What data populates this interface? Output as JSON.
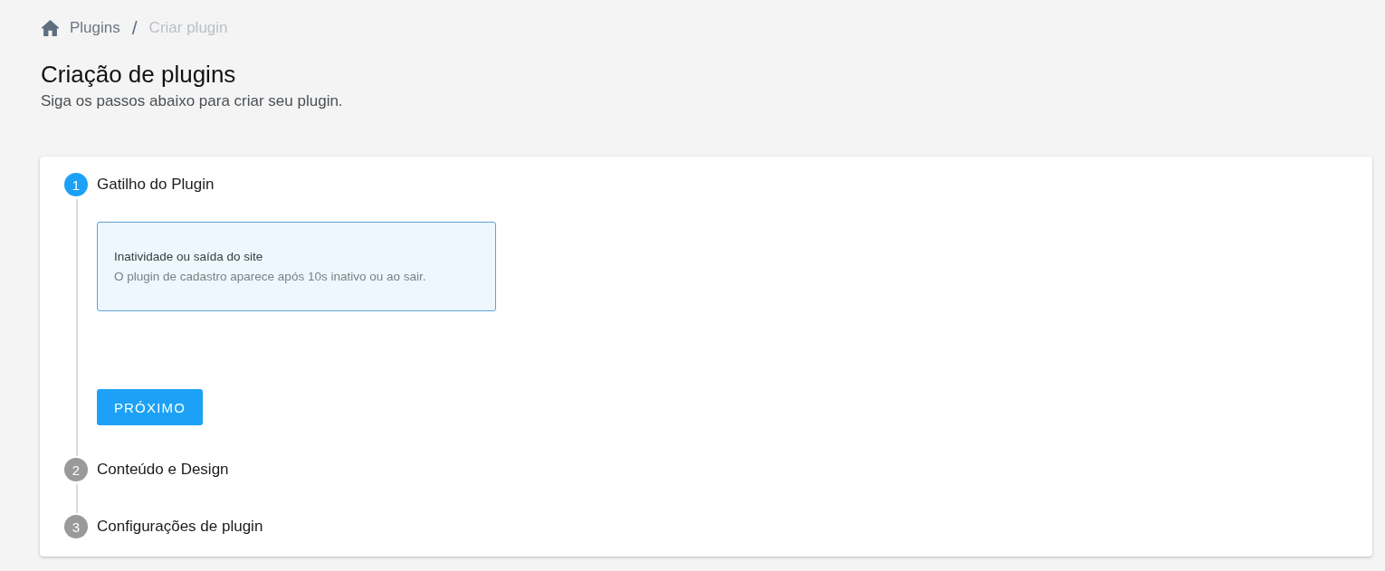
{
  "breadcrumb": {
    "items": [
      {
        "label": "Plugins",
        "current": false
      },
      {
        "label": "Criar plugin",
        "current": true
      }
    ],
    "separator": "/"
  },
  "header": {
    "title": "Criação de plugins",
    "subtitle": "Siga os passos abaixo para criar seu plugin."
  },
  "steps": [
    {
      "number": "1",
      "label": "Gatilho do Plugin",
      "active": true,
      "options": [
        {
          "title": "Inatividade ou saída do site",
          "description": "O plugin de cadastro aparece após 10s inativo ou ao sair.",
          "selected": true
        }
      ],
      "button": "PRÓXIMO"
    },
    {
      "number": "2",
      "label": "Conteúdo e Design",
      "active": false
    },
    {
      "number": "3",
      "label": "Configurações de plugin",
      "active": false
    }
  ]
}
